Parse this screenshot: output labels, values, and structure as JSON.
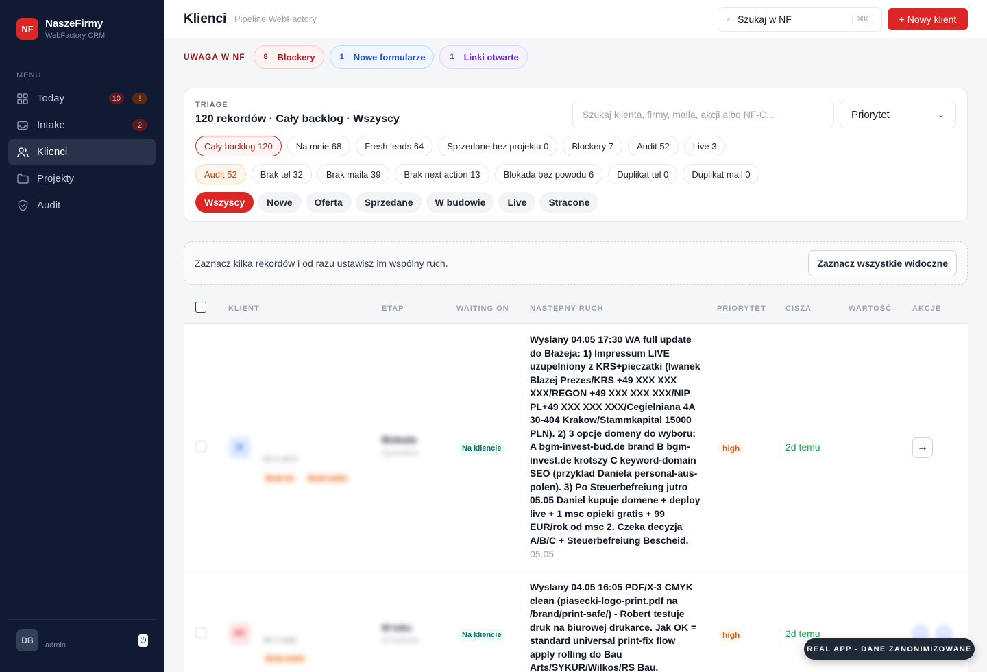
{
  "sidebar": {
    "brand": {
      "logo": "NF",
      "name": "NaszeFirmy",
      "sub": "WebFactory CRM"
    },
    "menu_label": "MENU",
    "items": [
      {
        "label": "Today",
        "icon": "grid-icon",
        "badges": [
          "10",
          "!"
        ]
      },
      {
        "label": "Intake",
        "icon": "inbox-icon",
        "badges": [
          "2"
        ]
      },
      {
        "label": "Klienci",
        "icon": "users-icon",
        "active": true
      },
      {
        "label": "Projekty",
        "icon": "folder-icon"
      },
      {
        "label": "Audit",
        "icon": "shield-icon"
      }
    ],
    "user": {
      "initials": "DB",
      "role": "admin",
      "logout_icon": "power-icon"
    }
  },
  "topbar": {
    "title": "Klienci",
    "subtitle": "Pipeline WebFactory",
    "search_label": "Szukaj w NF",
    "search_shortcut": "⌘K",
    "new_client": "+ Nowy klient"
  },
  "alerts": {
    "label": "UWAGA W NF",
    "items": [
      {
        "count": "8",
        "label": "Blockery",
        "color": "#b91c1c"
      },
      {
        "count": "1",
        "label": "Nowe formularze",
        "color": "#1d4ed8"
      },
      {
        "count": "1",
        "label": "Linki otwarte",
        "color": "#6d28d9"
      }
    ]
  },
  "triage": {
    "label": "TRIAGE",
    "title": "120 rekordów · Cały backlog · Wszyscy",
    "search_placeholder": "Szukaj klienta, firmy, maila, akcji albo NF-C...",
    "priority_select": "Priorytet",
    "scope_chips": [
      "Cały backlog 120",
      "Na mnie 68",
      "Fresh leads 64",
      "Sprzedane bez projektu 0",
      "Blockery 7",
      "Audit 52",
      "Live 3"
    ],
    "audit_chips": [
      "Audit 52",
      "Brak tel 32",
      "Brak maila 39",
      "Brak next action 13",
      "Blokada bez powodu 6",
      "Duplikat tel 0",
      "Duplikat mail 0"
    ],
    "stage_chips": [
      "Wszyscy",
      "Nowe",
      "Oferta",
      "Sprzedane",
      "W budowie",
      "Live",
      "Stracone"
    ]
  },
  "bulk": {
    "text": "Zaznacz kilka rekordów i od razu ustawisz im wspólny ruch.",
    "button": "Zaznacz wszystkie widoczne"
  },
  "table": {
    "columns": [
      "KLIENT",
      "ETAP",
      "WAITING ON",
      "NASTĘPNY RUCH",
      "PRIORYTET",
      "CISZA",
      "WARTOŚĆ",
      "AKCJE"
    ],
    "rows": [
      {
        "logo": "B",
        "client_id": "NF-C-0472",
        "tags": [
          "Brak tel",
          "Brak maila"
        ],
        "stage": "Blokada",
        "stage_sub": "Sprzedane",
        "waiting_on": "Na kliencie",
        "next_action": "Wyslany 04.05 17:30 WA full update do Błażeja: 1) Impressum LIVE uzupelniony z KRS+pieczatki (Iwanek Blazej Prezes/KRS +49 XXX XXX XXX/REGON +49 XXX XXX XXX/NIP PL+49 XXX XXX XXX/Cegielniana 4A 30-404 Krakow/Stammkapital 15000 PLN). 2) 3 opcje domeny do wyboru: A bgm-invest-bud.de brand B bgm-invest.de krotszy C keyword-domain SEO (przyklad Daniela personal-aus-polen). 3) Po Steuerbefreiung jutro 05.05 Daniel kupuje domene + deploy live + 1 msc opieki gratis + 99 EUR/rok od msc 2. Czeka decyzja A/B/C + Steuerbefreiung Bescheid.",
        "next_date": "05.05",
        "priority": "high",
        "silence": "2d temu",
        "action_icon": "arrow-right-icon"
      },
      {
        "logo": "RP",
        "client_id": "NF-C-0461",
        "tags": [
          "Brak maila"
        ],
        "stage": "W toku",
        "stage_sub": "W budowie",
        "waiting_on": "Na kliencie",
        "next_action": "Wyslany 04.05 16:05 PDF/X-3 CMYK clean (piasecki-logo-print.pdf na /brand/print-safe/) - Robert testuje druk na biurowej drukarce. Jak OK = standard universal print-fix flow apply rolling do Bau Arts/SYKUR/Wilkos/RS Bau.",
        "next_date": "",
        "priority": "high",
        "silence": "2d temu",
        "action_icon": "edit-icon"
      }
    ]
  },
  "demo_badge": "REAL APP - DANE ZANONIMIZOWANE",
  "colors": {
    "accent": "#dc2626",
    "sidebar_bg": "#101b33",
    "success": "#16a34a",
    "warning": "#ea580c"
  }
}
